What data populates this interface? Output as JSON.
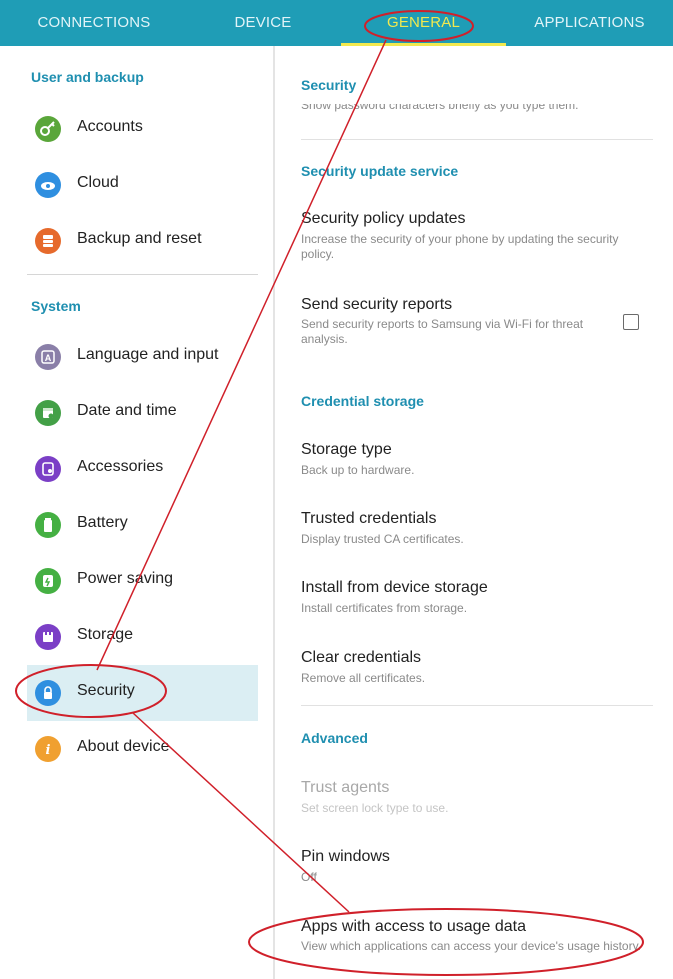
{
  "tabs": [
    {
      "label": "CONNECTIONS"
    },
    {
      "label": "DEVICE"
    },
    {
      "label": "GENERAL"
    },
    {
      "label": "APPLICATIONS"
    }
  ],
  "active_tab": "GENERAL",
  "sidebar": {
    "section_user": "User and backup",
    "section_system": "System",
    "items": [
      {
        "label": "Accounts",
        "icon": "key-icon",
        "color": "#5aa63a"
      },
      {
        "label": "Cloud",
        "icon": "cloud-icon",
        "color": "#2f8fe0"
      },
      {
        "label": "Backup and reset",
        "icon": "backup-icon",
        "color": "#e66a2c"
      },
      {
        "label": "Language and input",
        "icon": "language-icon",
        "color": "#8a7fa8"
      },
      {
        "label": "Date and time",
        "icon": "calendar-icon",
        "color": "#43a047"
      },
      {
        "label": "Accessories",
        "icon": "accessories-icon",
        "color": "#7b3fc6"
      },
      {
        "label": "Battery",
        "icon": "battery-icon",
        "color": "#45b043"
      },
      {
        "label": "Power saving",
        "icon": "power-saving-icon",
        "color": "#45b043"
      },
      {
        "label": "Storage",
        "icon": "storage-icon",
        "color": "#7b3fc6"
      },
      {
        "label": "Security",
        "icon": "lock-icon",
        "color": "#2f8fe0"
      },
      {
        "label": "About device",
        "icon": "info-icon",
        "color": "#f0a030"
      }
    ],
    "selected": "Security"
  },
  "content": {
    "header_security": "Security",
    "cut_text": "Show password characters briefly as you type them.",
    "header_update_service": "Security update service",
    "policy_title": "Security policy updates",
    "policy_sub": "Increase the security of your phone by updating the security policy.",
    "reports_title": "Send security reports",
    "reports_sub": "Send security reports to Samsung via Wi-Fi for threat analysis.",
    "header_credential": "Credential storage",
    "storage_type_title": "Storage type",
    "storage_type_sub": "Back up to hardware.",
    "trusted_title": "Trusted credentials",
    "trusted_sub": "Display trusted CA certificates.",
    "install_title": "Install from device storage",
    "install_sub": "Install certificates from storage.",
    "clear_title": "Clear credentials",
    "clear_sub": "Remove all certificates.",
    "header_advanced": "Advanced",
    "trust_agents_title": "Trust agents",
    "trust_agents_sub": "Set screen lock type to use.",
    "pin_title": "Pin windows",
    "pin_sub": "Off",
    "usage_title": "Apps with access to usage data",
    "usage_sub": "View which applications can access your device's usage history."
  },
  "colors": {
    "tab_bar": "#1f9db6",
    "active_tab": "#f2e94e",
    "accent_header": "#1f8fb0",
    "annotation": "#d0202a"
  }
}
